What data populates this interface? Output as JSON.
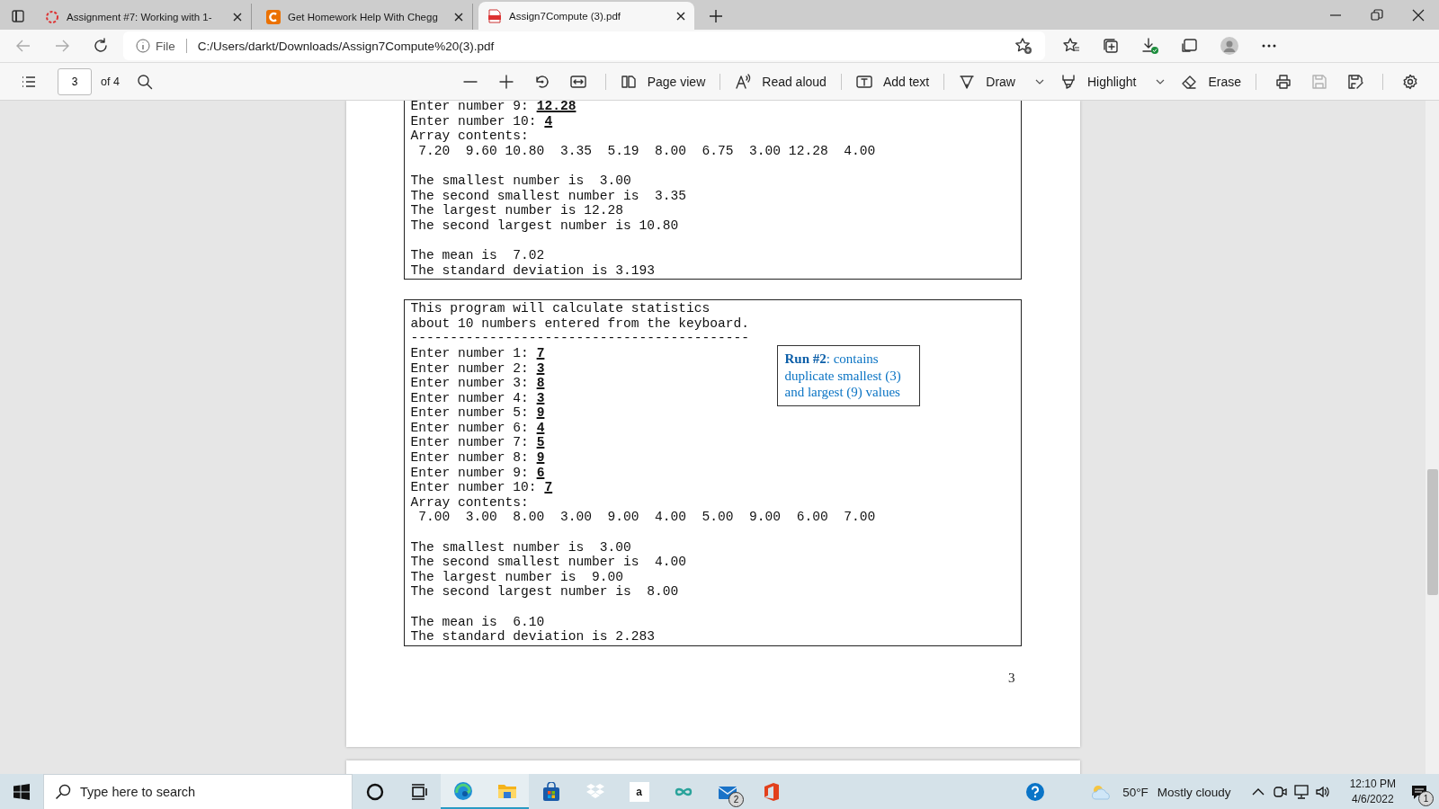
{
  "browser": {
    "tabs": [
      {
        "title": "Assignment #7: Working with 1-",
        "selected": false
      },
      {
        "title": "Get Homework Help With Chegg",
        "selected": false
      },
      {
        "title": "Assign7Compute (3).pdf",
        "selected": true
      }
    ],
    "address": {
      "scheme": "File",
      "url": "C:/Users/darkt/Downloads/Assign7Compute%20(3).pdf"
    }
  },
  "pdf_toolbar": {
    "page": "3",
    "page_count": "of 4",
    "tools": [
      {
        "kind": "page-view",
        "label": "Page view",
        "menu": false
      },
      {
        "kind": "read-aloud",
        "label": "Read aloud",
        "menu": false
      },
      {
        "kind": "add-text",
        "label": "Add text",
        "menu": false
      },
      {
        "kind": "draw",
        "label": "Draw",
        "menu": true
      },
      {
        "kind": "highlight",
        "label": "Highlight",
        "menu": true
      },
      {
        "kind": "erase",
        "label": "Erase",
        "menu": false
      }
    ],
    "actions": [
      {
        "kind": "print",
        "disabled": false
      },
      {
        "kind": "save",
        "disabled": true
      },
      {
        "kind": "save-as",
        "disabled": false
      }
    ]
  },
  "document": {
    "consoles": [
      {
        "clipped_top": true,
        "paragraphs": [
          [
            {
              "text": "Enter number 9: ",
              "input": "12.28"
            },
            {
              "text": "Enter number 10: ",
              "input": "4"
            },
            {
              "text": "Array contents:"
            },
            {
              "text": " 7.20  9.60 10.80  3.35  5.19  8.00  6.75  3.00 12.28  4.00"
            }
          ],
          [
            {
              "text": "The smallest number is  3.00"
            },
            {
              "text": "The second smallest number is  3.35"
            },
            {
              "text": "The largest number is 12.28"
            },
            {
              "text": "The second largest number is 10.80"
            }
          ],
          [
            {
              "text": "The mean is  7.02"
            },
            {
              "text": "The standard deviation is 3.193"
            }
          ]
        ]
      },
      {
        "clipped_top": false,
        "note": "**Run #2**: contains duplicate smallest (3) and largest (9) values",
        "paragraphs": [
          [
            {
              "text": "This program will calculate statistics"
            },
            {
              "text": "about 10 numbers entered from the keyboard."
            },
            {
              "text": "-------------------------------------------"
            },
            {
              "text": "Enter number 1: ",
              "input": "7"
            },
            {
              "text": "Enter number 2: ",
              "input": "3"
            },
            {
              "text": "Enter number 3: ",
              "input": "8"
            },
            {
              "text": "Enter number 4: ",
              "input": "3"
            },
            {
              "text": "Enter number 5: ",
              "input": "9"
            },
            {
              "text": "Enter number 6: ",
              "input": "4"
            },
            {
              "text": "Enter number 7: ",
              "input": "5"
            },
            {
              "text": "Enter number 8: ",
              "input": "9"
            },
            {
              "text": "Enter number 9: ",
              "input": "6"
            },
            {
              "text": "Enter number 10: ",
              "input": "7"
            },
            {
              "text": "Array contents:"
            },
            {
              "text": " 7.00  3.00  8.00  3.00  9.00  4.00  5.00  9.00  6.00  7.00"
            }
          ],
          [
            {
              "text": "The smallest number is  3.00"
            },
            {
              "text": "The second smallest number is  4.00"
            },
            {
              "text": "The largest number is  9.00"
            },
            {
              "text": "The second largest number is  8.00"
            }
          ],
          [
            {
              "text": "The mean is  6.10"
            },
            {
              "text": "The standard deviation is 2.283"
            }
          ]
        ]
      }
    ],
    "page_number": "3"
  },
  "taskbar": {
    "search": {
      "placeholder": "Type here to search"
    },
    "apps": [
      {
        "kind": "cortana",
        "running": false
      },
      {
        "kind": "task-view",
        "running": false
      },
      {
        "kind": "edge",
        "running": true
      },
      {
        "kind": "explorer",
        "running": true
      },
      {
        "kind": "store",
        "running": false
      },
      {
        "kind": "dropbox",
        "running": false
      },
      {
        "kind": "amazon",
        "running": false,
        "letter": "a"
      },
      {
        "kind": "infinity",
        "running": false
      },
      {
        "kind": "mail",
        "running": false,
        "badge": "2"
      },
      {
        "kind": "office",
        "running": false
      }
    ],
    "weather": {
      "temperature": "50°F",
      "condition": "Mostly cloudy"
    },
    "clock": {
      "time": "12:10 PM",
      "date": "4/6/2022"
    },
    "notifications": {
      "badge": "1"
    }
  }
}
